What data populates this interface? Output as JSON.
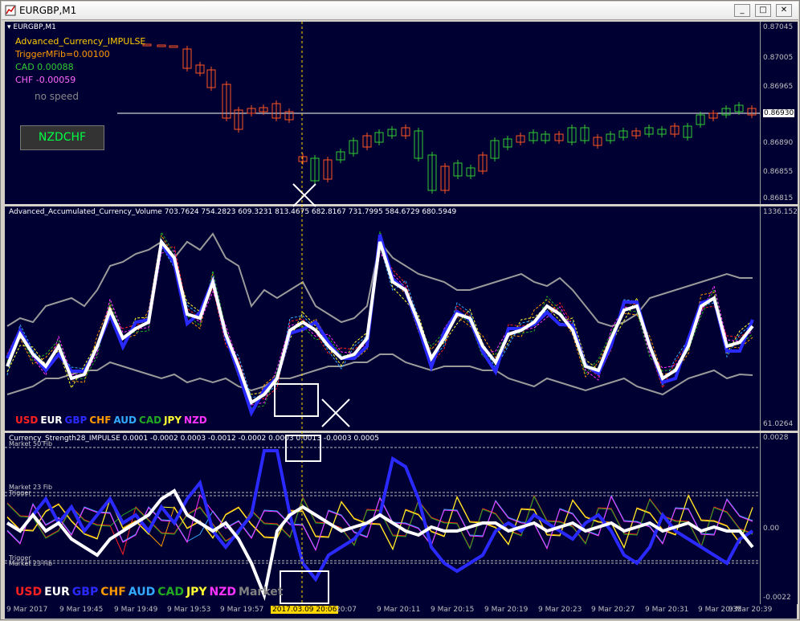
{
  "window": {
    "title": "EURGBP,M1",
    "min": "_",
    "max": "□",
    "close": "✕"
  },
  "panel1": {
    "chart_label": "EURGBP,M1",
    "lines": [
      "Advanced_Currency_IMPULSE",
      "TriggerMFib=0.00100",
      "CAD 0.00088",
      "CHF -0.00059",
      "no speed"
    ],
    "button": "NZDCHF",
    "price_ticks": [
      "0.87045",
      "0.87005",
      "0.86965",
      "0.86930",
      "0.86890",
      "0.86855",
      "0.86815"
    ],
    "current_price": "0.86930"
  },
  "panel2": {
    "header": "Advanced_Accumulated_Currency_Volume 703.7624 754.2823 609.3231 813.4675 682.8167 731.7995 584.6729 680.5949",
    "top_value": "1336.152",
    "bottom_value": "61.0264",
    "legend": [
      "USD",
      "EUR",
      "GBP",
      "CHF",
      "AUD",
      "CAD",
      "JPY",
      "NZD"
    ]
  },
  "panel3": {
    "header": "Currency_Strength28_IMPULSE 0.0001 -0.0002 0.0003 -0.0012 -0.0002 0.0003 0.0013 -0.0003 0.0005",
    "ticks": [
      "0.0028",
      "0.00",
      "-0.0022"
    ],
    "levels": [
      "Market 50 Fib",
      "Market 23 Fib",
      "Trigger",
      "Trigger",
      "Market 23 Fib"
    ],
    "legend": [
      "USD",
      "EUR",
      "GBP",
      "CHF",
      "AUD",
      "CAD",
      "JPY",
      "NZD",
      "Market"
    ]
  },
  "time_axis": [
    "9 Mar 2017",
    "9 Mar 19:45",
    "9 Mar 19:49",
    "9 Mar 19:53",
    "9 Mar 19:57",
    "2017.03.09 20:06",
    "20:07",
    "9 Mar 20:11",
    "9 Mar 20:15",
    "9 Mar 20:19",
    "9 Mar 20:23",
    "9 Mar 20:27",
    "9 Mar 20:31",
    "9 Mar 20:35",
    "9 Mar 20:39"
  ],
  "colors": {
    "USD": "#ff2020",
    "EUR": "#ffffff",
    "GBP": "#2a2aff",
    "CHF": "#ff9900",
    "AUD": "#33aaff",
    "CAD": "#22aa22",
    "JPY": "#ffff33",
    "NZD": "#ff33ff",
    "Market": "#808080",
    "bg": "#000033",
    "bull": "#33cc33",
    "bear": "#ff5522"
  }
}
